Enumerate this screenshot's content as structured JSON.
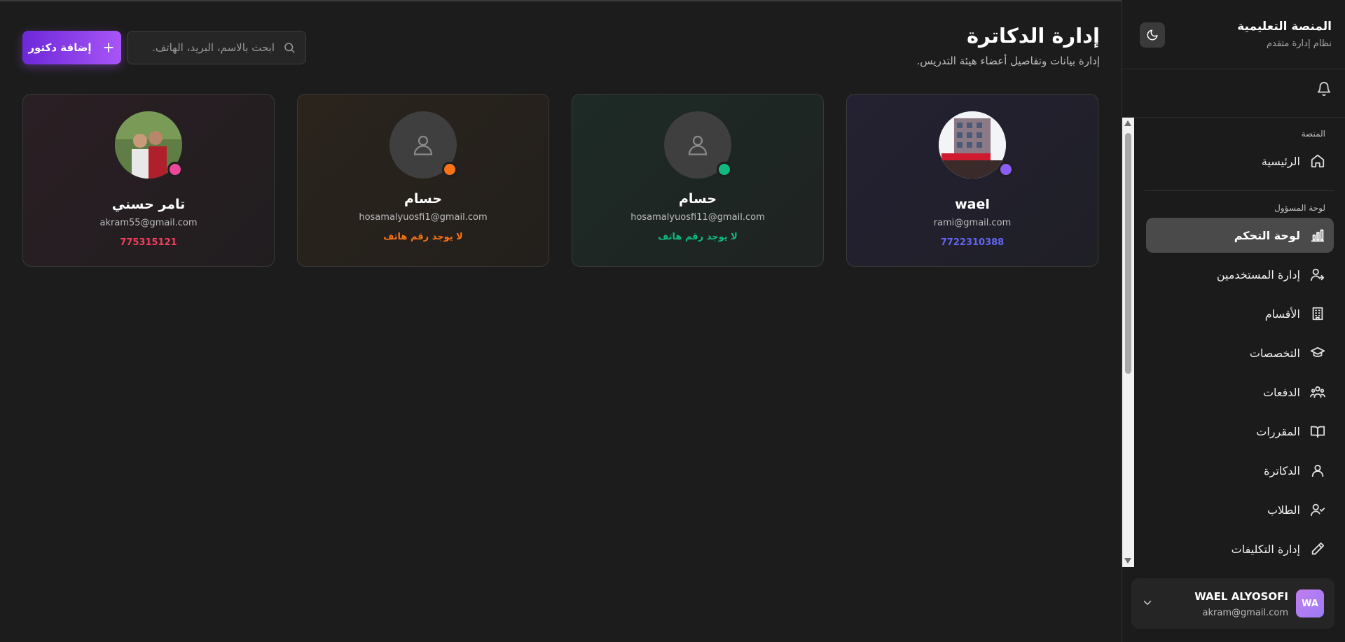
{
  "sidebar": {
    "brand_title": "المنصة التعليمية",
    "brand_subtitle": "نظام إدارة متقدم",
    "section_platform": "المنصة",
    "section_admin": "لوحة المسؤول",
    "items": [
      {
        "label": "الرئيسية",
        "icon": "home-icon"
      },
      {
        "label": "لوحة التحكم",
        "icon": "bar-chart-icon",
        "active": true
      },
      {
        "label": "إدارة المستخدمين",
        "icon": "users-manage-icon"
      },
      {
        "label": "الأقسام",
        "icon": "building-icon"
      },
      {
        "label": "التخصصات",
        "icon": "graduation-cap-icon"
      },
      {
        "label": "الدفعات",
        "icon": "group-icon"
      },
      {
        "label": "المقررات",
        "icon": "book-icon"
      },
      {
        "label": "الدكاترة",
        "icon": "user-icon"
      },
      {
        "label": "الطلاب",
        "icon": "students-icon"
      },
      {
        "label": "إدارة التكليفات",
        "icon": "pencil-icon"
      }
    ],
    "user": {
      "initials": "WA",
      "name": "WAEL ALYOSOFI",
      "email": "akram@gmail.com"
    }
  },
  "main": {
    "title": "إدارة الدكاترة",
    "subtitle": "إدارة بيانات وتفاصيل أعضاء هيئة التدريس.",
    "search_placeholder": "ابحث بالاسم، البريد، الهاتف...",
    "add_button": "إضافة دكتور",
    "doctors": [
      {
        "name": "wael",
        "email": "rami@gmail.com",
        "phone": "7722310388",
        "accent": "#8b5cf6",
        "phone_color": "#6366f1",
        "avatar": "photo-building"
      },
      {
        "name": "حسام",
        "email": "hosamalyuosfi11@gmail.com",
        "phone": "لا يوجد رقم هاتف",
        "accent": "#10b981",
        "phone_color": "#10b981",
        "avatar": "placeholder"
      },
      {
        "name": "حسام",
        "email": "hosamalyuosfi1@gmail.com",
        "phone": "لا يوجد رقم هاتف",
        "accent": "#f97316",
        "phone_color": "#f97316",
        "avatar": "placeholder"
      },
      {
        "name": "تامر حسني",
        "email": "akram55@gmail.com",
        "phone": "775315121",
        "accent": "#ec4899",
        "phone_color": "#f43f5e",
        "avatar": "photo-people"
      }
    ]
  }
}
